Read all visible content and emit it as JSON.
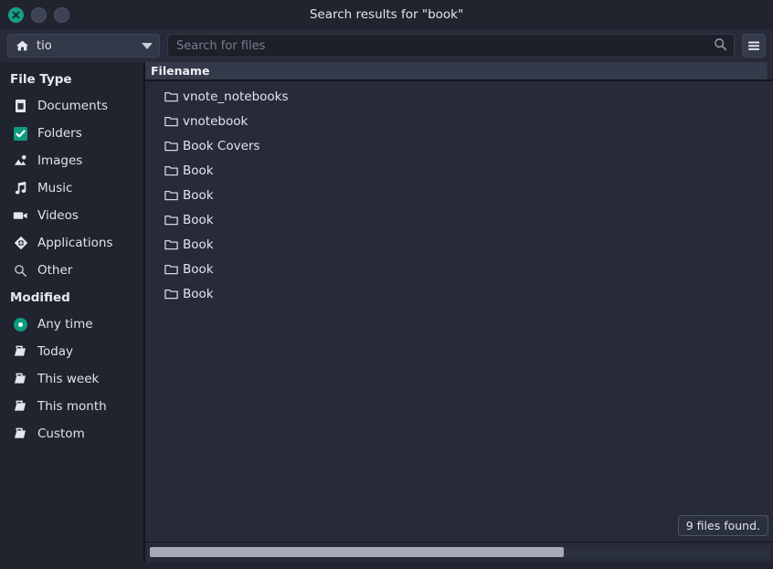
{
  "window": {
    "title": "Search results for \"book\"",
    "controls": [
      {
        "name": "close-button",
        "icon": "close-icon",
        "color": "#16a085"
      },
      {
        "name": "minimize-button",
        "icon": "minimize-icon",
        "color": "#3d4355"
      },
      {
        "name": "maximize-button",
        "icon": "maximize-icon",
        "color": "#3d4355"
      }
    ]
  },
  "toolbar": {
    "path_button": {
      "icon": "home-icon",
      "label": "tio",
      "chevron": "chevron-down-icon"
    },
    "search": {
      "placeholder": "Search for files",
      "value": "",
      "icon": "search-icon"
    },
    "menu_button": {
      "icon": "hamburger-menu-icon"
    }
  },
  "sidebar": {
    "groups": [
      {
        "title": "File Type",
        "items": [
          {
            "label": "Documents",
            "icon": "document-icon",
            "selected": false
          },
          {
            "label": "Folders",
            "icon": "checkbox-checked-icon",
            "selected": true
          },
          {
            "label": "Images",
            "icon": "image-icon",
            "selected": false
          },
          {
            "label": "Music",
            "icon": "music-note-icon",
            "selected": false
          },
          {
            "label": "Videos",
            "icon": "video-camera-icon",
            "selected": false
          },
          {
            "label": "Applications",
            "icon": "application-icon",
            "selected": false
          },
          {
            "label": "Other",
            "icon": "search-icon",
            "selected": false
          }
        ]
      },
      {
        "title": "Modified",
        "items": [
          {
            "label": "Any time",
            "icon": "radio-selected-icon",
            "selected": true
          },
          {
            "label": "Today",
            "icon": "calendar-page-icon",
            "selected": false
          },
          {
            "label": "This week",
            "icon": "calendar-page-icon",
            "selected": false
          },
          {
            "label": "This month",
            "icon": "calendar-page-icon",
            "selected": false
          },
          {
            "label": "Custom",
            "icon": "calendar-page-icon",
            "selected": false
          }
        ]
      }
    ]
  },
  "results": {
    "column_header": "Filename",
    "rows": [
      {
        "name": "vnote_notebooks",
        "icon": "folder-icon"
      },
      {
        "name": "vnotebook",
        "icon": "folder-icon"
      },
      {
        "name": "Book Covers",
        "icon": "folder-icon"
      },
      {
        "name": "Book",
        "icon": "folder-icon"
      },
      {
        "name": "Book",
        "icon": "folder-icon"
      },
      {
        "name": "Book",
        "icon": "folder-icon"
      },
      {
        "name": "Book",
        "icon": "folder-icon"
      },
      {
        "name": "Book",
        "icon": "folder-icon"
      },
      {
        "name": "Book",
        "icon": "folder-icon"
      }
    ],
    "status": "9 files found."
  },
  "colors": {
    "accent": "#0f9b7e",
    "window_bg": "#272b39",
    "sidebar_bg": "#20242f",
    "titlebar_bg": "#21242f",
    "header_bg": "#343a4a",
    "text": "#e2e5ec",
    "muted_text": "#767d8e",
    "scrollbar_thumb": "#a6aab4"
  }
}
